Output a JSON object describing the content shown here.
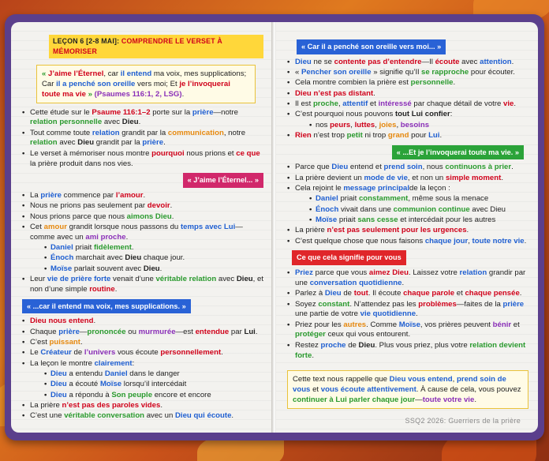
{
  "left": {
    "title_part1": "LEÇON 6 [2-8 MAI]:",
    "title_part2": "COMPRENDRE LE VERSET À MÉMORISER",
    "quote": [
      "« ",
      "J’aime l’Éternel",
      ", car ",
      "il entend",
      " ma voix, mes supplications; Car ",
      "il a penché son oreille",
      " vers moi; Et ",
      "je l’invoquerai toute ma vie",
      " » ",
      "(Psaumes 116:1, 2, LSG)",
      "."
    ],
    "intro": [
      [
        "Cette étude sur le ",
        "Psaume 116:1–2",
        " porte sur la ",
        "prière",
        "—notre ",
        "relation personnelle",
        " avec ",
        "Dieu",
        "."
      ],
      [
        "Tout comme toute ",
        "relation",
        " grandit par la ",
        "communication",
        ", notre ",
        "relation",
        " avec ",
        "Dieu",
        " grandit par la ",
        "prière",
        "."
      ],
      [
        "Le verset à mémoriser nous montre ",
        "pourquoi",
        " nous prions et ",
        "ce que",
        " la prière produit dans nos vies."
      ]
    ],
    "section1": {
      "header": "« J’aime l’Éternel... »",
      "items": [
        [
          "La ",
          "prière",
          " commence par ",
          "l’amour",
          "."
        ],
        [
          "Nous ne prions pas seulement par ",
          "devoir",
          "."
        ],
        [
          "Nous prions parce que nous ",
          "aimons Dieu",
          "."
        ],
        [
          "Cet ",
          "amour",
          " grandit lorsque nous passons du ",
          "temps avec Lui",
          "—comme avec un ",
          "ami proche",
          "."
        ]
      ],
      "sub": [
        [
          "Daniel",
          " priait ",
          "fidèlement",
          "."
        ],
        [
          "Énoch",
          " marchait avec ",
          "Dieu",
          " chaque jour."
        ],
        [
          "Moïse",
          " parlait souvent avec ",
          "Dieu",
          "."
        ]
      ],
      "last": [
        "Leur ",
        "vie de prière forte",
        " venait d’une ",
        "véritable relation",
        " avec ",
        "Dieu",
        ", et non d’une simple ",
        "routine",
        "."
      ]
    },
    "section2": {
      "header": "« ...car il entend ma voix, mes supplications. »",
      "items": [
        [
          "Dieu nous entend",
          "."
        ],
        [
          "Chaque ",
          "prière",
          "—",
          "prononcée",
          " ou ",
          "murmurée",
          "—est ",
          "entendue",
          " par ",
          "Lui",
          "."
        ],
        [
          "C’est ",
          "puissant",
          "."
        ],
        [
          "Le ",
          "Créateur",
          " de ",
          "l’univers",
          " vous écoute ",
          "personnellement",
          "."
        ],
        [
          "La leçon le montre ",
          "clairement",
          ":"
        ]
      ],
      "sub": [
        [
          "Dieu",
          " a entendu ",
          "Daniel",
          " dans le danger"
        ],
        [
          "Dieu",
          " a écouté ",
          "Moïse",
          " lorsqu’il intercédait"
        ],
        [
          "Dieu",
          " a répondu à ",
          "Son peuple",
          " encore et encore"
        ]
      ],
      "last": [
        [
          "La prière ",
          "n’est pas des paroles vides",
          "."
        ],
        [
          "C’est une ",
          "véritable conversation",
          " avec un ",
          "Dieu qui écoute",
          "."
        ]
      ]
    }
  },
  "right": {
    "section3": {
      "header": "« Car il a penché son oreille vers moi... »",
      "items": [
        [
          "Dieu",
          " ne se ",
          "contente pas d’entendre",
          "—Il ",
          "écoute",
          " avec ",
          "attention",
          "."
        ],
        [
          "« ",
          "Pencher son oreille",
          " » signifie qu’Il ",
          "se rapproche",
          " pour écouter."
        ],
        [
          "Cela montre combien la prière est ",
          "personnelle",
          "."
        ],
        [
          "Dieu n’est pas distant",
          "."
        ],
        [
          "Il est ",
          "proche",
          ", ",
          "attentif",
          " et ",
          "intéressé",
          " par chaque détail de votre ",
          "vie",
          "."
        ],
        [
          "C’est pourquoi nous pouvons ",
          "tout Lui confier",
          ":"
        ]
      ],
      "sub": [
        "nos ",
        "peurs",
        ", ",
        "luttes",
        ", ",
        "joies",
        ", ",
        "besoins"
      ],
      "last": [
        "Rien",
        " n’est trop ",
        "petit",
        " ni trop ",
        "grand",
        " pour ",
        "Lui",
        "."
      ]
    },
    "section4": {
      "header": "« ...Et je l’invoquerai toute ma vie. »",
      "items": [
        [
          "Parce que ",
          "Dieu",
          " entend et ",
          "prend soin",
          ", nous ",
          "continuons à prier",
          "."
        ],
        [
          "La prière devient un ",
          "mode de vie",
          ", et non un ",
          "simple moment",
          "."
        ],
        [
          "Cela rejoint le ",
          "message principal",
          "de la leçon :"
        ]
      ],
      "sub": [
        [
          "Daniel",
          " priait ",
          "constamment",
          ", même sous la menace"
        ],
        [
          "Énoch",
          " vivait dans une ",
          "communion continue",
          " avec Dieu"
        ],
        [
          "Moïse",
          " priait ",
          "sans cesse",
          " et intercédait pour les autres"
        ]
      ],
      "last": [
        [
          "La prière ",
          "n’est pas seulement pour les urgences",
          "."
        ],
        [
          "C’est quelque chose que nous faisons ",
          "chaque jour",
          ", ",
          "toute notre vie",
          "."
        ]
      ]
    },
    "section5": {
      "header": "Ce que cela signifie pour vous",
      "items": [
        [
          "Priez",
          " parce que vous ",
          "aimez Dieu",
          ". Laissez votre ",
          "relation",
          " grandir par une ",
          "conversation quotidienne",
          "."
        ],
        [
          "Parlez à ",
          "Dieu",
          " de ",
          "tout",
          ". Il écoute ",
          "chaque parole",
          " et ",
          "chaque pensée",
          "."
        ],
        [
          "Soyez ",
          "constant",
          ". N’attendez pas les ",
          "problèmes",
          "—faites de la ",
          "prière",
          " une partie de votre ",
          "vie quotidienne",
          "."
        ],
        [
          "Priez pour les ",
          "autres",
          ". Comme ",
          "Moïse",
          ", vos prières peuvent ",
          "bénir",
          " et ",
          "protéger",
          " ceux qui vous entourent."
        ],
        [
          "Restez ",
          "proche",
          " de ",
          "Dieu",
          ". Plus vous priez, plus votre ",
          "relation devient forte",
          "."
        ]
      ]
    },
    "note": [
      "Cette text nous rappelle que ",
      "Dieu vous entend",
      ", ",
      "prend soin de vous",
      " et ",
      "vous écoute attentivement",
      ". À cause de cela, vous pouvez ",
      "continuer à Lui parler chaque jour",
      "—",
      "toute votre vie",
      "."
    ],
    "footer": "SSQ2 2026: Guerriers de la prière"
  }
}
